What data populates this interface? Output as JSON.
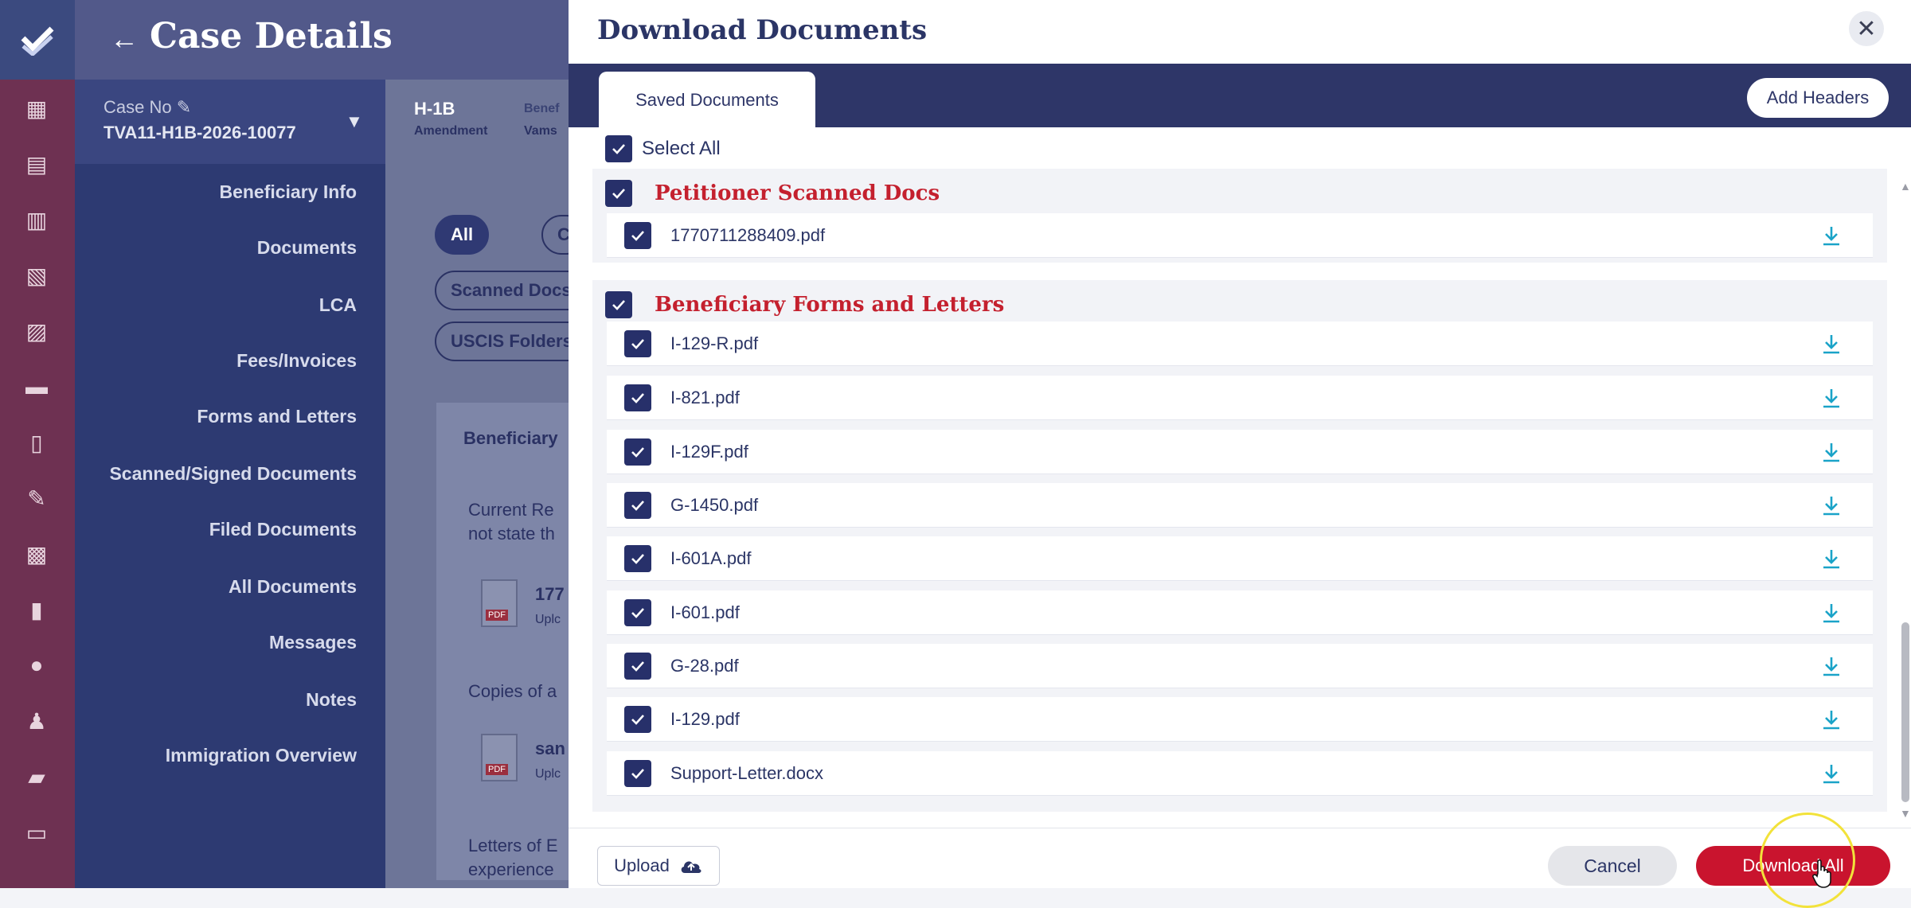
{
  "app": {
    "page_title": "Case Details",
    "case": {
      "label": "Case No",
      "number": "TVA11-H1B-2026-10077"
    },
    "visa": {
      "type": "H-1B",
      "subtype": "Amendment",
      "benef_label": "Benef",
      "benef_value": "Vams"
    },
    "nav": [
      "Beneficiary Info",
      "Documents",
      "LCA",
      "Fees/Invoices",
      "Forms and Letters",
      "Scanned/Signed Documents",
      "Filed Documents",
      "All Documents",
      "Messages",
      "Notes",
      "Immigration Overview"
    ],
    "filters": {
      "all": "All",
      "c": "C",
      "scanned": "Scanned Docs",
      "uscis": "USCIS Folders"
    },
    "bg": {
      "section_title": "Beneficiary",
      "current_res_1": "Current Re",
      "current_res_2": "not state th",
      "file_1": "177",
      "file_1_sub": "Uplc",
      "copies": "Copies of a",
      "file_2": "san",
      "file_2_sub": "Uplc",
      "letters_1": "Letters of E",
      "letters_2": "experience"
    },
    "pdf_badge": "PDF"
  },
  "modal": {
    "title": "Download Documents",
    "close_glyph": "✕",
    "tab": "Saved Documents",
    "add_headers": "Add Headers",
    "select_all": "Select All",
    "sections": [
      {
        "title": "Petitioner Scanned Docs",
        "files": [
          "1770711288409.pdf"
        ]
      },
      {
        "title": "Beneficiary Forms and Letters",
        "files": [
          "I-129-R.pdf",
          "I-821.pdf",
          "I-129F.pdf",
          "G-1450.pdf",
          "I-601A.pdf",
          "I-601.pdf",
          "G-28.pdf",
          "I-129.pdf",
          "Support-Letter.docx"
        ]
      }
    ],
    "footer": {
      "upload": "Upload",
      "cancel": "Cancel",
      "download_all": "Download All"
    }
  },
  "colors": {
    "navy": "#27306a",
    "accent_red": "#c4202e",
    "download_icon": "#1aa3c8",
    "button_red": "#c9142e"
  }
}
